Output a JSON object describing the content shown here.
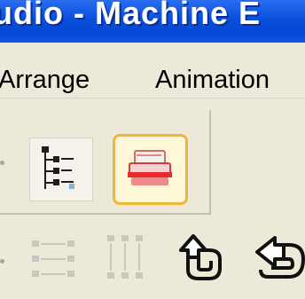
{
  "window": {
    "title": "udio - Machine E"
  },
  "menu": {
    "items": [
      {
        "label": "Arrange"
      },
      {
        "label": "Animation"
      }
    ]
  },
  "toolbar1": {
    "buttons": [
      {
        "icon": "tree-view-icon",
        "state": "pressed"
      },
      {
        "icon": "print-preview-icon",
        "state": "hover"
      }
    ]
  },
  "toolbar2": {
    "buttons": [
      {
        "icon": "align-rows-icon",
        "state": "disabled"
      },
      {
        "icon": "align-columns-icon",
        "state": "disabled"
      },
      {
        "icon": "undo-icon",
        "state": "enabled"
      },
      {
        "icon": "redo-icon",
        "state": "enabled"
      }
    ]
  },
  "colors": {
    "titlebar": "#0a4fdc",
    "chrome": "#ece9d8",
    "active_border": "#f0b63a"
  }
}
